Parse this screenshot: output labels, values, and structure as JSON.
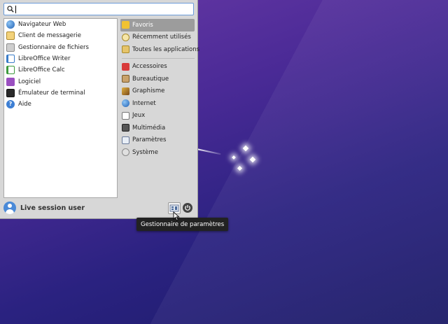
{
  "search": {
    "value": ""
  },
  "favorites": [
    {
      "label": "Navigateur Web",
      "icon": "web-browser-icon"
    },
    {
      "label": "Client de messagerie",
      "icon": "mail-client-icon"
    },
    {
      "label": "Gestionnaire de fichiers",
      "icon": "file-manager-icon"
    },
    {
      "label": "LibreOffice Writer",
      "icon": "writer-icon"
    },
    {
      "label": "LibreOffice Calc",
      "icon": "calc-icon"
    },
    {
      "label": "Logiciel",
      "icon": "software-icon"
    },
    {
      "label": "Émulateur de terminal",
      "icon": "terminal-icon"
    },
    {
      "label": "Aide",
      "icon": "help-icon"
    }
  ],
  "categories_top": [
    {
      "label": "Favoris",
      "icon": "star-icon",
      "selected": true
    },
    {
      "label": "Récemment utilisés",
      "icon": "recent-icon"
    },
    {
      "label": "Toutes les applications",
      "icon": "all-apps-icon"
    }
  ],
  "categories": [
    {
      "label": "Accessoires",
      "icon": "accessories-icon"
    },
    {
      "label": "Bureautique",
      "icon": "office-icon"
    },
    {
      "label": "Graphisme",
      "icon": "graphics-icon"
    },
    {
      "label": "Internet",
      "icon": "internet-icon"
    },
    {
      "label": "Jeux",
      "icon": "games-icon"
    },
    {
      "label": "Multimédia",
      "icon": "multimedia-icon"
    },
    {
      "label": "Paramètres",
      "icon": "settings-icon"
    },
    {
      "label": "Système",
      "icon": "system-icon"
    }
  ],
  "user": {
    "name": "Live session user"
  },
  "tooltip": {
    "text": "Gestionnaire de paramètres"
  },
  "colors": {
    "accent": "#6b9bd8",
    "selected": "#9c9c9c",
    "panel": "#d7d7d7"
  }
}
